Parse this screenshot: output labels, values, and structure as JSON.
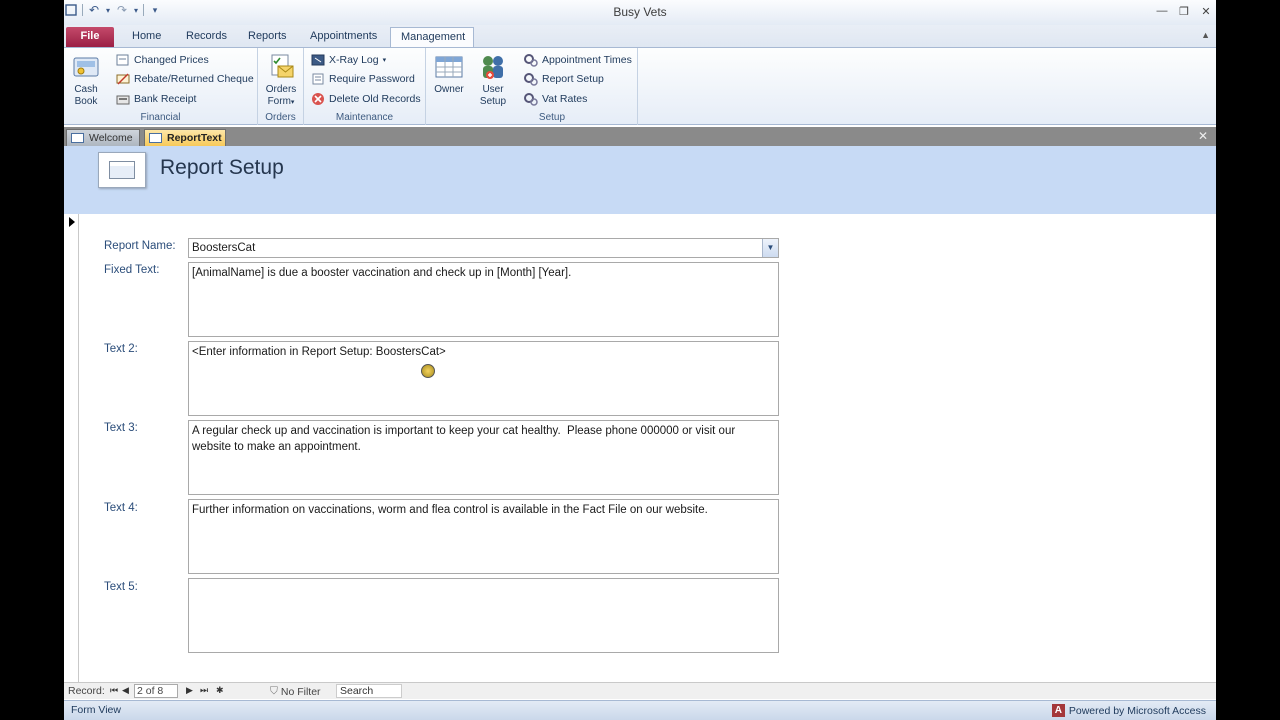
{
  "window": {
    "title": "Busy Vets"
  },
  "ribbon_tabs": [
    {
      "label": "File"
    },
    {
      "label": "Home"
    },
    {
      "label": "Records"
    },
    {
      "label": "Reports"
    },
    {
      "label": "Appointments"
    },
    {
      "label": "Management"
    }
  ],
  "ribbon": {
    "financial": {
      "label": "Financial",
      "cash_book": {
        "line1": "Cash",
        "line2": "Book"
      },
      "items": [
        {
          "label": "Changed Prices"
        },
        {
          "label": "Rebate/Returned Cheque"
        },
        {
          "label": "Bank Receipt"
        }
      ]
    },
    "orders": {
      "label": "Orders",
      "orders_form": {
        "line1": "Orders",
        "line2": "Form"
      }
    },
    "maintenance": {
      "label": "Maintenance",
      "items": [
        {
          "label": "X-Ray Log"
        },
        {
          "label": "Require Password"
        },
        {
          "label": "Delete Old Records"
        }
      ]
    },
    "owner": {
      "label": "Owner"
    },
    "setup": {
      "label": "Setup",
      "user_setup": {
        "line1": "User",
        "line2": "Setup"
      },
      "items": [
        {
          "label": "Appointment Times"
        },
        {
          "label": "Report Setup"
        },
        {
          "label": "Vat Rates"
        }
      ]
    }
  },
  "doc_tabs": [
    {
      "label": "Welcome"
    },
    {
      "label": "ReportText"
    }
  ],
  "form": {
    "title": "Report Setup",
    "report_name_label": "Report Name:",
    "report_name_value": "BoostersCat",
    "fields": [
      {
        "label": "Fixed Text:",
        "value": "[AnimalName] is due a booster vaccination and check up in [Month] [Year]."
      },
      {
        "label": "Text 2:",
        "value": "<Enter information in Report Setup: BoostersCat>"
      },
      {
        "label": "Text 3:",
        "value": "A regular check up and vaccination is important to keep your cat healthy.  Please phone 000000 or visit our website to make an appointment."
      },
      {
        "label": "Text 4:",
        "value": "Further information on vaccinations, worm and flea control is available in the Fact File on our website."
      },
      {
        "label": "Text 5:",
        "value": ""
      }
    ]
  },
  "navigation": {
    "record_label": "Record:",
    "position": "2 of 8",
    "filter": "No Filter",
    "search": "Search"
  },
  "status": {
    "view": "Form View",
    "powered_by": "Powered by Microsoft Access"
  },
  "colors": {
    "file_tab": "#9b1f44",
    "form_header": "#c7daf5",
    "active_doc_tab": "#f7c95a",
    "label_text": "#2b4d7a"
  }
}
